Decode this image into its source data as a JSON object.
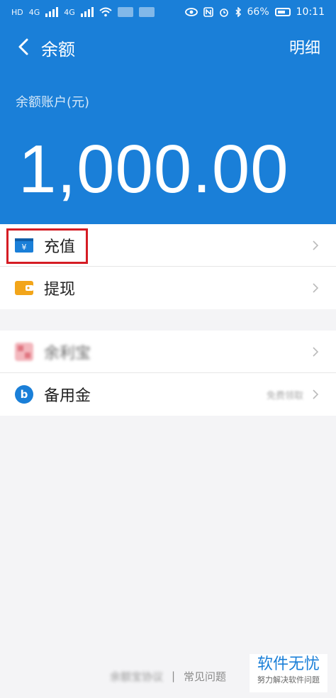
{
  "status_bar": {
    "left_labels": [
      "HD",
      "4G",
      "4G"
    ],
    "battery": "66%",
    "time": "10:11"
  },
  "header": {
    "title": "余额",
    "detail": "明细",
    "balance_label": "余额账户(元)",
    "balance_amount": "1,000.00"
  },
  "actions": [
    {
      "label": "充值",
      "icon": "yuan-card-icon",
      "highlighted": true
    },
    {
      "label": "提现",
      "icon": "wallet-icon",
      "highlighted": false
    }
  ],
  "services": [
    {
      "label": "余利宝",
      "icon": "blurred-logo-icon",
      "right_text": ""
    },
    {
      "label": "备用金",
      "icon": "b-circle-icon",
      "right_text": "免费领取"
    }
  ],
  "footer": {
    "left": "余额宝协议",
    "separator": "|",
    "right": "常见问题"
  },
  "watermark": {
    "title": "软件无忧",
    "subtitle": "努力解决软件问题"
  },
  "colors": {
    "primary": "#1a7fd8",
    "highlight": "#d51c24",
    "wallet": "#f2a51a"
  }
}
